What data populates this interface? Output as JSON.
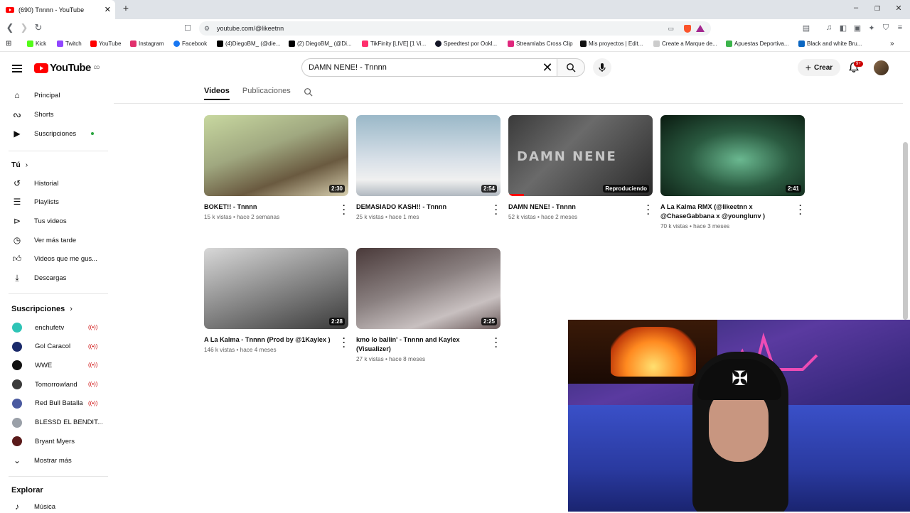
{
  "browser": {
    "tab_title": "(690) Tnnnn - YouTube",
    "url": "youtube.com/@likeetnn",
    "bookmarks": [
      {
        "label": "Kick",
        "color": "#53fc18"
      },
      {
        "label": "Twitch",
        "color": "#9146ff"
      },
      {
        "label": "YouTube",
        "color": "#ff0000"
      },
      {
        "label": "Instagram",
        "color": "#e1306c"
      },
      {
        "label": "Facebook",
        "color": "#1877f2"
      },
      {
        "label": "(4)DiegoBM_ (@die...",
        "color": "#000000"
      },
      {
        "label": "(2) DiegoBM_ (@Di...",
        "color": "#000000"
      },
      {
        "label": "TikFinity [LIVE] [1 Vi...",
        "color": "#ff2f6d"
      },
      {
        "label": "Speedtest por Ookl...",
        "color": "#141526"
      },
      {
        "label": "Streamlabs Cross Clip",
        "color": "#e0287d"
      },
      {
        "label": "Mis proyectos | Edit...",
        "color": "#111111"
      },
      {
        "label": "Create a Marque de...",
        "color": "#cccccc"
      },
      {
        "label": "Apuestas Deportiva...",
        "color": "#3cb44b"
      },
      {
        "label": "Black and white Bru...",
        "color": "#0a66c2"
      }
    ]
  },
  "header": {
    "logo_text": "YouTube",
    "region": "CO",
    "search_value": "DAMN NENE! - Tnnnn",
    "create_label": "Crear",
    "notification_count": "9+"
  },
  "sidebar": {
    "main": [
      {
        "label": "Principal",
        "icon": "home-icon"
      },
      {
        "label": "Shorts",
        "icon": "shorts-icon"
      },
      {
        "label": "Suscripciones",
        "icon": "subscriptions-icon"
      }
    ],
    "you_title": "Tú",
    "you": [
      {
        "label": "Historial",
        "icon": "history-icon"
      },
      {
        "label": "Playlists",
        "icon": "playlists-icon"
      },
      {
        "label": "Tus videos",
        "icon": "your-videos-icon"
      },
      {
        "label": "Ver más tarde",
        "icon": "watch-later-icon"
      },
      {
        "label": "Videos que me gus...",
        "icon": "liked-icon"
      },
      {
        "label": "Descargas",
        "icon": "download-icon"
      }
    ],
    "subs_title": "Suscripciones",
    "subs": [
      {
        "label": "enchufetv",
        "color": "#2ec4b6",
        "live": true
      },
      {
        "label": "Gol Caracol",
        "color": "#1a2a6a",
        "live": true
      },
      {
        "label": "WWE",
        "color": "#111111",
        "live": true
      },
      {
        "label": "Tomorrowland",
        "color": "#3a3a3a",
        "live": true
      },
      {
        "label": "Red Bull Batalla",
        "color": "#4a5aa0",
        "live": true
      },
      {
        "label": "BLESSD EL BENDIT...",
        "color": "#9aa0a8",
        "live": false
      },
      {
        "label": "Bryant Myers",
        "color": "#5a1a1a",
        "live": false
      }
    ],
    "show_more": "Mostrar más",
    "explore_title": "Explorar",
    "explore": [
      {
        "label": "Música",
        "icon": "music-icon"
      }
    ],
    "live_symbol": "((•))"
  },
  "channel_tabs": {
    "videos": "Videos",
    "posts": "Publicaciones"
  },
  "videos": [
    {
      "title": "BOKET!! - Tnnnn",
      "views": "15 k vistas",
      "age": "hace 2 semanas",
      "duration": "2:30"
    },
    {
      "title": "DEMASIADO KASH!! - Tnnnn",
      "views": "25 k vistas",
      "age": "hace 1 mes",
      "duration": "2:54"
    },
    {
      "title": "DAMN NENE! - Tnnnn",
      "views": "52 k vistas",
      "age": "hace 2 meses",
      "duration": "Reproduciendo",
      "thumb_text": "DAMN NENE"
    },
    {
      "title": "A La Kalma RMX (@likeetnn x @ChaseGabbana x @younglunv )",
      "views": "70 k vistas",
      "age": "hace 3 meses",
      "duration": "2:41"
    },
    {
      "title": "A La Kalma - Tnnnn (Prod by @1Kaylex )",
      "views": "146 k vistas",
      "age": "hace 4 meses",
      "duration": "2:28"
    },
    {
      "title": "kmo lo ballin' - Tnnnn and Kaylex (Visualizer)",
      "views": "27 k vistas",
      "age": "hace 8 meses",
      "duration": "2:25"
    }
  ],
  "meta_separator": "•"
}
